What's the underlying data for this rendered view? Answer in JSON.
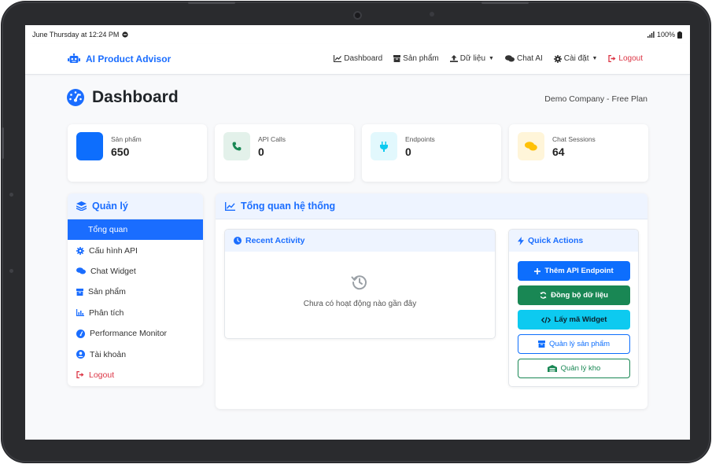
{
  "status": {
    "time": "June Thursday at 12:24 PM",
    "battery": "100%"
  },
  "brand": {
    "name": "AI Product Advisor"
  },
  "nav": {
    "dashboard": "Dashboard",
    "products": "Sản phẩm",
    "data": "Dữ liệu",
    "chat": "Chat AI",
    "settings": "Cài đặt",
    "logout": "Logout"
  },
  "header": {
    "title": "Dashboard",
    "company": "Demo Company - Free Plan"
  },
  "stats": [
    {
      "label": "Sản phẩm",
      "value": "650",
      "icon": "box-icon",
      "color": "#0d6efd"
    },
    {
      "label": "API Calls",
      "value": "0",
      "icon": "phone-icon",
      "color": "#198754"
    },
    {
      "label": "Endpoints",
      "value": "0",
      "icon": "plug-icon",
      "color": "#0dcaf0"
    },
    {
      "label": "Chat Sessions",
      "value": "64",
      "icon": "comments-icon",
      "color": "#ffc107"
    }
  ],
  "sidebar": {
    "title": "Quản lý",
    "items": [
      {
        "label": "Tổng quan",
        "icon": ""
      },
      {
        "label": "Cấu hình API",
        "icon": "gear-icon"
      },
      {
        "label": "Chat Widget",
        "icon": "comments-icon"
      },
      {
        "label": "Sản phẩm",
        "icon": "box-icon"
      },
      {
        "label": "Phân tích",
        "icon": "chart-icon"
      },
      {
        "label": "Performance Monitor",
        "icon": "gauge-icon"
      },
      {
        "label": "Tài khoản",
        "icon": "user-icon"
      },
      {
        "label": "Logout",
        "icon": "logout-icon"
      }
    ]
  },
  "main": {
    "title": "Tổng quan hệ thống",
    "recent": {
      "title": "Recent Activity",
      "empty": "Chưa có hoạt động nào gần đây"
    },
    "quick": {
      "title": "Quick Actions",
      "buttons": [
        "Thêm API Endpoint",
        "Đồng bộ dữ liệu",
        "Lấy mã Widget",
        "Quản lý sản phẩm",
        "Quản lý kho"
      ]
    }
  },
  "colors": {
    "accent": "#1a6dff",
    "danger": "#dc3545"
  }
}
